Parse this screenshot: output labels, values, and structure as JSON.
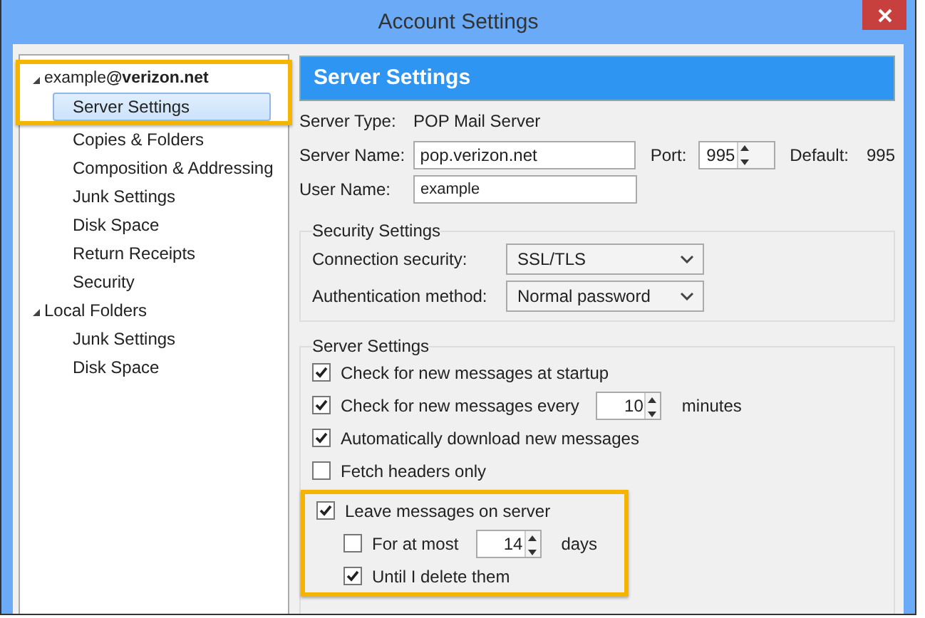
{
  "window": {
    "title": "Account Settings"
  },
  "tree": [
    {
      "label": "example**@verizon.net**",
      "expanded": true,
      "highlighted": true,
      "children": [
        {
          "label": "Server Settings",
          "selected": true
        },
        {
          "label": "Copies & Folders",
          "selected": false
        },
        {
          "label": "Composition & Addressing",
          "selected": false
        },
        {
          "label": "Junk Settings",
          "selected": false
        },
        {
          "label": "Disk Space",
          "selected": false
        },
        {
          "label": "Return Receipts",
          "selected": false
        },
        {
          "label": "Security",
          "selected": false
        }
      ]
    },
    {
      "label": "Local Folders",
      "expanded": true,
      "highlighted": false,
      "children": [
        {
          "label": "Junk Settings",
          "selected": false
        },
        {
          "label": "Disk Space",
          "selected": false
        }
      ]
    }
  ],
  "panel": {
    "title": "Server Settings",
    "server_type": {
      "label": "Server Type:",
      "value": "POP Mail Server"
    },
    "server_name": {
      "label": "Server Name:",
      "value": "pop.verizon.net"
    },
    "port": {
      "label": "Port:",
      "value": "995"
    },
    "default": {
      "label": "Default:",
      "value": "995"
    },
    "user_name": {
      "label": "User Name:",
      "value": "example"
    },
    "security": {
      "legend": "Security Settings",
      "fields": [
        {
          "label": "Connection security:",
          "value": "SSL/TLS"
        },
        {
          "label": "Authentication method:",
          "value": "Normal password"
        }
      ]
    },
    "server_settings": {
      "legend": "Server Settings",
      "options": [
        {
          "kind": "check",
          "label": "Check for new messages at startup",
          "checked": true
        },
        {
          "kind": "interval",
          "label": "Check for new messages every",
          "checked": true,
          "value": "10",
          "unit": "minutes"
        },
        {
          "kind": "check",
          "label": "Automatically download new messages",
          "checked": true
        },
        {
          "kind": "check",
          "label": "Fetch headers only",
          "checked": false
        }
      ],
      "leave": {
        "label": "Leave messages on server",
        "checked": true,
        "highlighted": true,
        "options": [
          {
            "kind": "interval",
            "label": "For at most",
            "checked": false,
            "value": "14",
            "unit": "days"
          },
          {
            "kind": "check",
            "label": "Until I delete them",
            "checked": true
          }
        ]
      }
    }
  }
}
